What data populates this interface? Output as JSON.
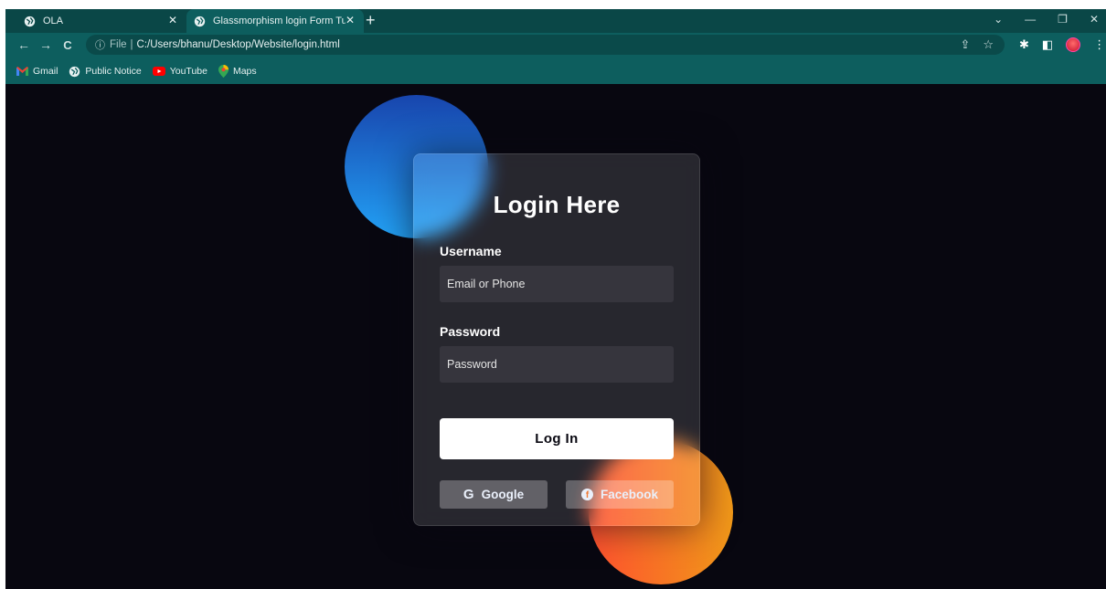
{
  "browser": {
    "tabs": [
      {
        "title": "OLA"
      },
      {
        "title": "Glassmorphism login Form Tutorial"
      }
    ],
    "address": {
      "scheme": "File",
      "separator": "|",
      "path": "C:/Users/bhanu/Desktop/Website/login.html"
    },
    "bookmarks": [
      {
        "label": "Gmail",
        "icon": "gmail-icon"
      },
      {
        "label": "Public Notice",
        "icon": "globe-icon"
      },
      {
        "label": "YouTube",
        "icon": "youtube-icon"
      },
      {
        "label": "Maps",
        "icon": "maps-icon"
      }
    ]
  },
  "login": {
    "title": "Login Here",
    "username_label": "Username",
    "username_placeholder": "Email or Phone",
    "password_label": "Password",
    "password_placeholder": "Password",
    "submit_label": "Log In",
    "google_label": "Google",
    "facebook_label": "Facebook"
  },
  "colors": {
    "page_bg": "#080710",
    "chrome": "#0d5e5e",
    "blue_circle": "#23a2f6",
    "orange_circle": "#f09819"
  }
}
